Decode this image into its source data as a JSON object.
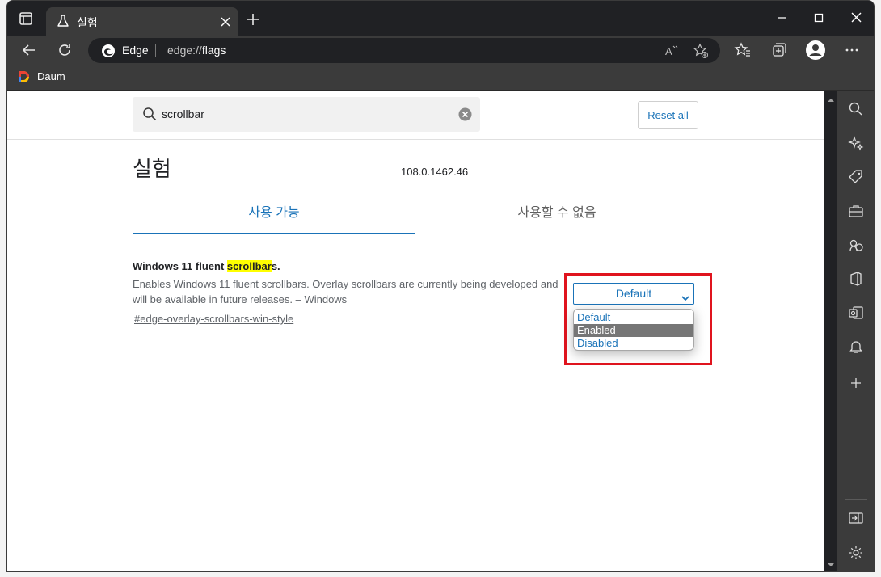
{
  "browser": {
    "tab": {
      "title": "실험"
    },
    "address": {
      "site_label": "Edge",
      "url_prefix": "edge://",
      "url_path": "flags"
    },
    "favorites": [
      {
        "label": "Daum"
      }
    ]
  },
  "page": {
    "search": {
      "value": "scrollbar",
      "placeholder": ""
    },
    "reset_label": "Reset all",
    "title": "실험",
    "version": "108.0.1462.46",
    "tabs": [
      {
        "label": "사용 가능"
      },
      {
        "label": "사용할 수 없음"
      }
    ],
    "flag": {
      "title_before": "Windows 11 fluent ",
      "title_highlight": "scrollbar",
      "title_after": "s.",
      "description": "Enables Windows 11 fluent scrollbars. Overlay scrollbars are currently being developed and will be available in future releases. – Windows",
      "link": "#edge-overlay-scrollbars-win-style",
      "selected_value": "Default",
      "options": [
        "Default",
        "Enabled",
        "Disabled"
      ],
      "highlighted_option": "Enabled"
    }
  },
  "colors": {
    "accent": "#1a73b8",
    "annotation_box": "#e0141e",
    "chrome_dark": "#202124",
    "chrome_mid": "#3b3b3b"
  },
  "icons": {
    "tab_actions": "tab-actions-icon",
    "tab": "flask-icon",
    "back": "back-arrow-icon",
    "refresh": "refresh-icon",
    "read_aloud": "read-aloud-icon",
    "add_favorite": "add-favorite-icon",
    "favorites": "favorites-icon",
    "collections": "collections-icon",
    "profile": "profile-icon",
    "more": "more-icon",
    "sidebar": [
      "search-icon",
      "sparkle-icon",
      "tag-icon",
      "briefcase-icon",
      "games-icon",
      "office-icon",
      "outlook-icon",
      "bell-icon",
      "add-icon"
    ]
  }
}
